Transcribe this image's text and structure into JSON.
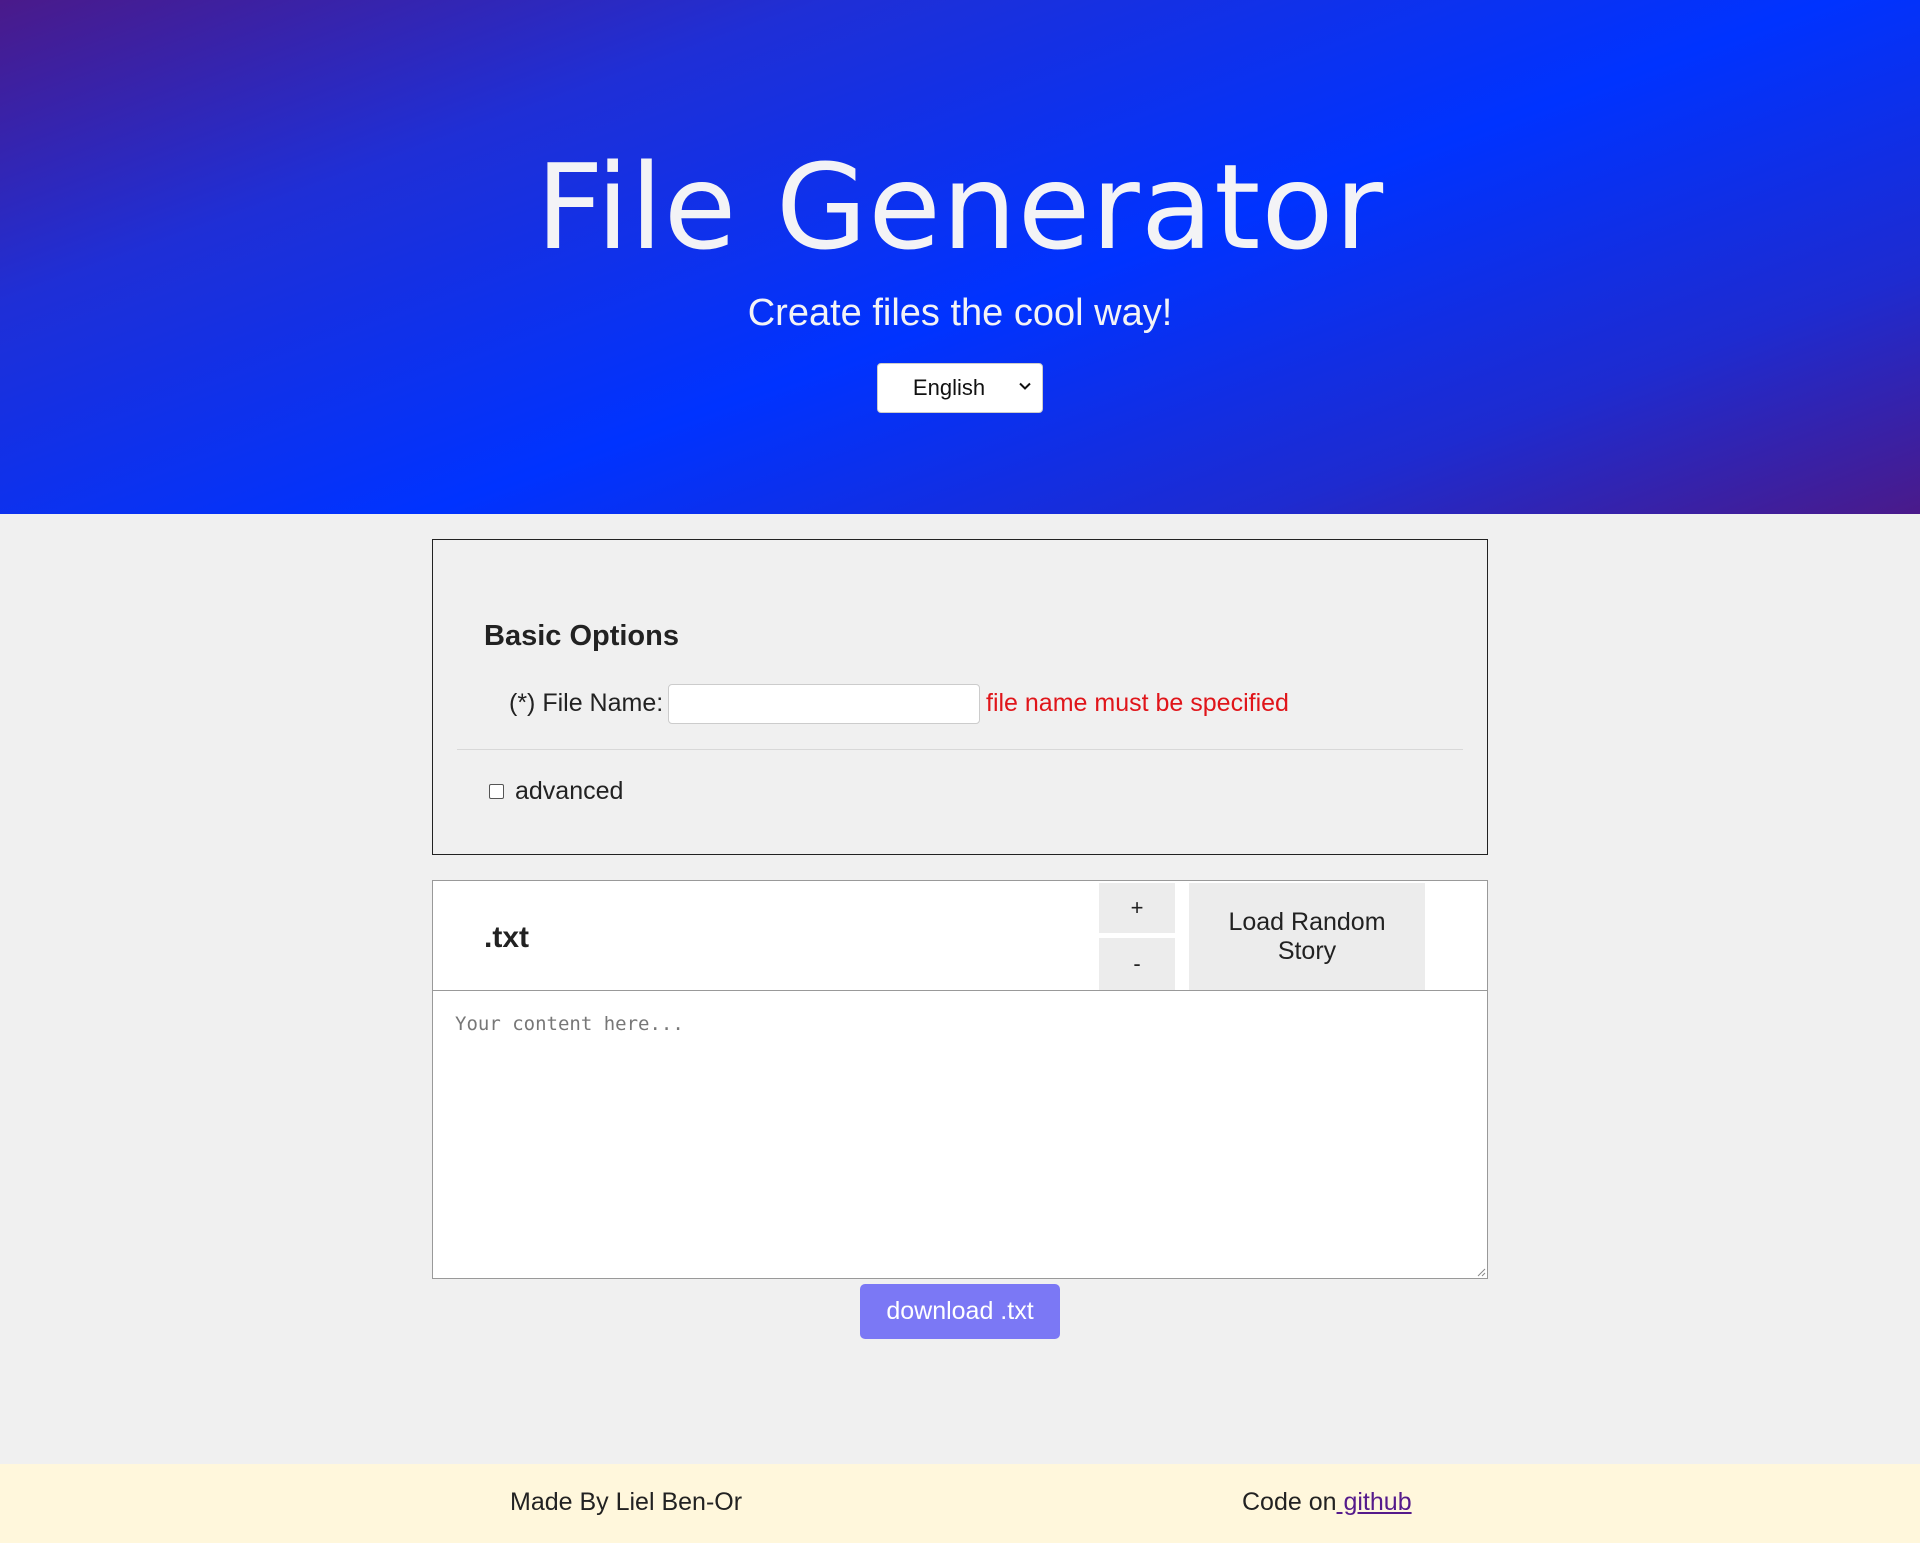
{
  "hero": {
    "title": "File Generator",
    "subtitle": "Create files the cool way!",
    "language": {
      "selected": "English"
    }
  },
  "basic_options": {
    "title": "Basic Options",
    "file_name_label": "(*) File Name:",
    "file_name_value": "",
    "file_name_error": "file name must be specified",
    "advanced_label": "advanced",
    "advanced_checked": false
  },
  "editor": {
    "extension_title": ".txt",
    "increase_label": "+",
    "decrease_label": "-",
    "random_story_label": "Load Random Story",
    "content_placeholder": "Your content here...",
    "content_value": "",
    "download_label": "download .txt"
  },
  "footer": {
    "credit": "Made By Liel Ben-Or",
    "code_prefix": "Code on",
    "code_link": " github"
  },
  "colors": {
    "hero_gradient_center": "#0033ff",
    "hero_gradient_edge": "#4a1a8a",
    "error": "#e0151a",
    "download_button": "#7b78f5",
    "footer_background": "#fff7dc",
    "link": "#551a8b"
  }
}
